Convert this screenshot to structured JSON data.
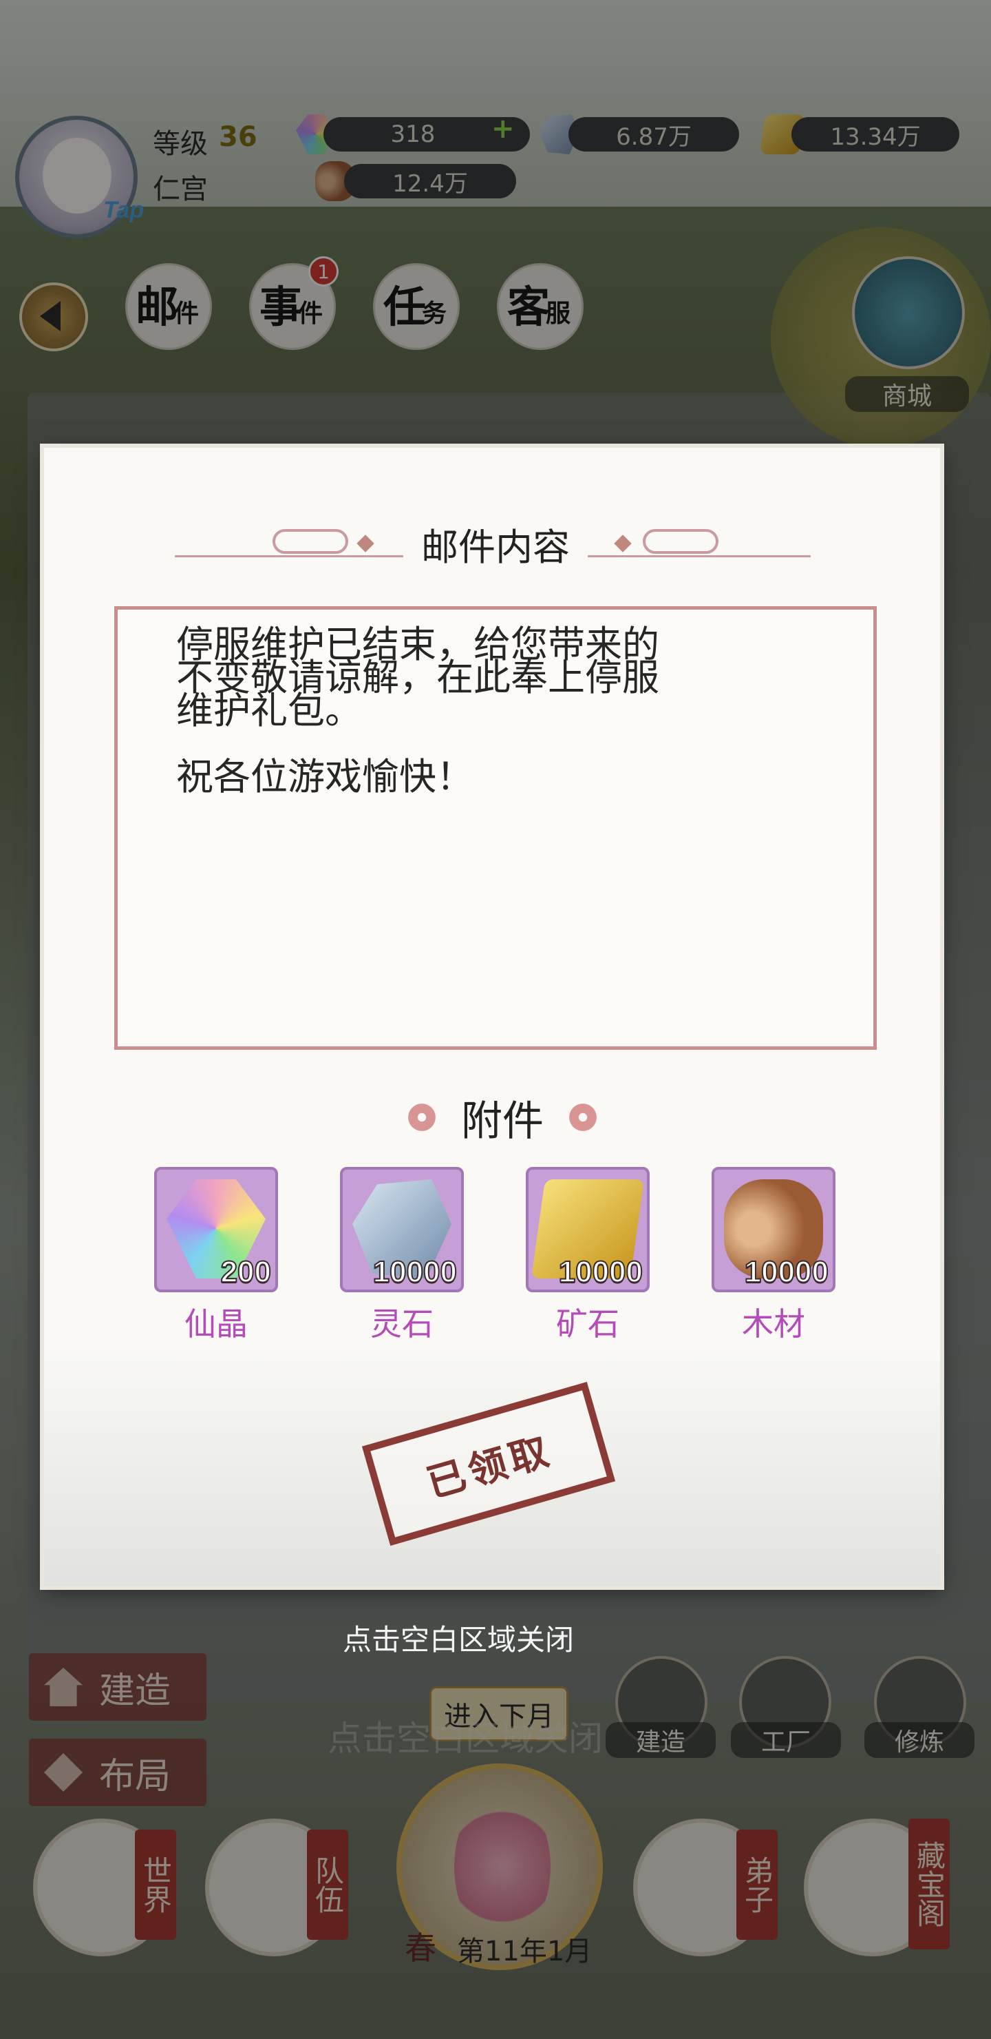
{
  "hud": {
    "level_label": "等级",
    "level_value": "36",
    "realm": "仁宫",
    "tap_tag": "Tap",
    "resources": [
      {
        "icon": "xianjing-gem-icon",
        "value": "318",
        "has_plus": true,
        "plus": "+"
      },
      {
        "icon": "lingshi-stone-icon",
        "value": "6.87万"
      },
      {
        "icon": "ore-gold-icon",
        "value": "13.34万"
      },
      {
        "icon": "wood-log-icon",
        "value": "12.4万"
      }
    ]
  },
  "tabs": [
    {
      "main": "邮",
      "sub": "件"
    },
    {
      "main": "事",
      "sub": "件"
    },
    {
      "main": "任",
      "sub": "务"
    },
    {
      "main": "客",
      "sub": "服"
    }
  ],
  "event_badge": "1",
  "shop_label": "商城",
  "mail": {
    "title": "邮件内容",
    "body": "停服维护已结束，给您带来的\n不变敬请谅解，在此奉上停服\n维护礼包。\n\n祝各位游戏愉快！",
    "attachments_title": "附件",
    "attachments": [
      {
        "name": "仙晶",
        "count": "200",
        "icon": "xianjing-gem-icon"
      },
      {
        "name": "灵石",
        "count": "10000",
        "icon": "lingshi-stone-icon"
      },
      {
        "name": "矿石",
        "count": "10000",
        "icon": "ore-gold-icon"
      },
      {
        "name": "木材",
        "count": "10000",
        "icon": "wood-log-icon"
      }
    ],
    "claimed_stamp": "已领取",
    "close_hint": "点击空白区域关闭"
  },
  "bottom": {
    "build_label": "建造",
    "layout_label": "布局",
    "next_month": "进入下月",
    "ghost_hint": "点击空白区域关闭",
    "season": "春",
    "date": "第11年1月",
    "mini_buttons": [
      "建造",
      "工厂",
      "修炼"
    ],
    "nav": [
      {
        "tag": "世界"
      },
      {
        "tag": "队伍"
      },
      {
        "tag": "弟子"
      },
      {
        "tag": "藏宝阁"
      }
    ]
  },
  "colors": {
    "stamp_red": "#8a3b36",
    "attachment_bg": "#c79fd7",
    "attachment_name": "#b54bb8",
    "content_border": "#c98f8f"
  }
}
